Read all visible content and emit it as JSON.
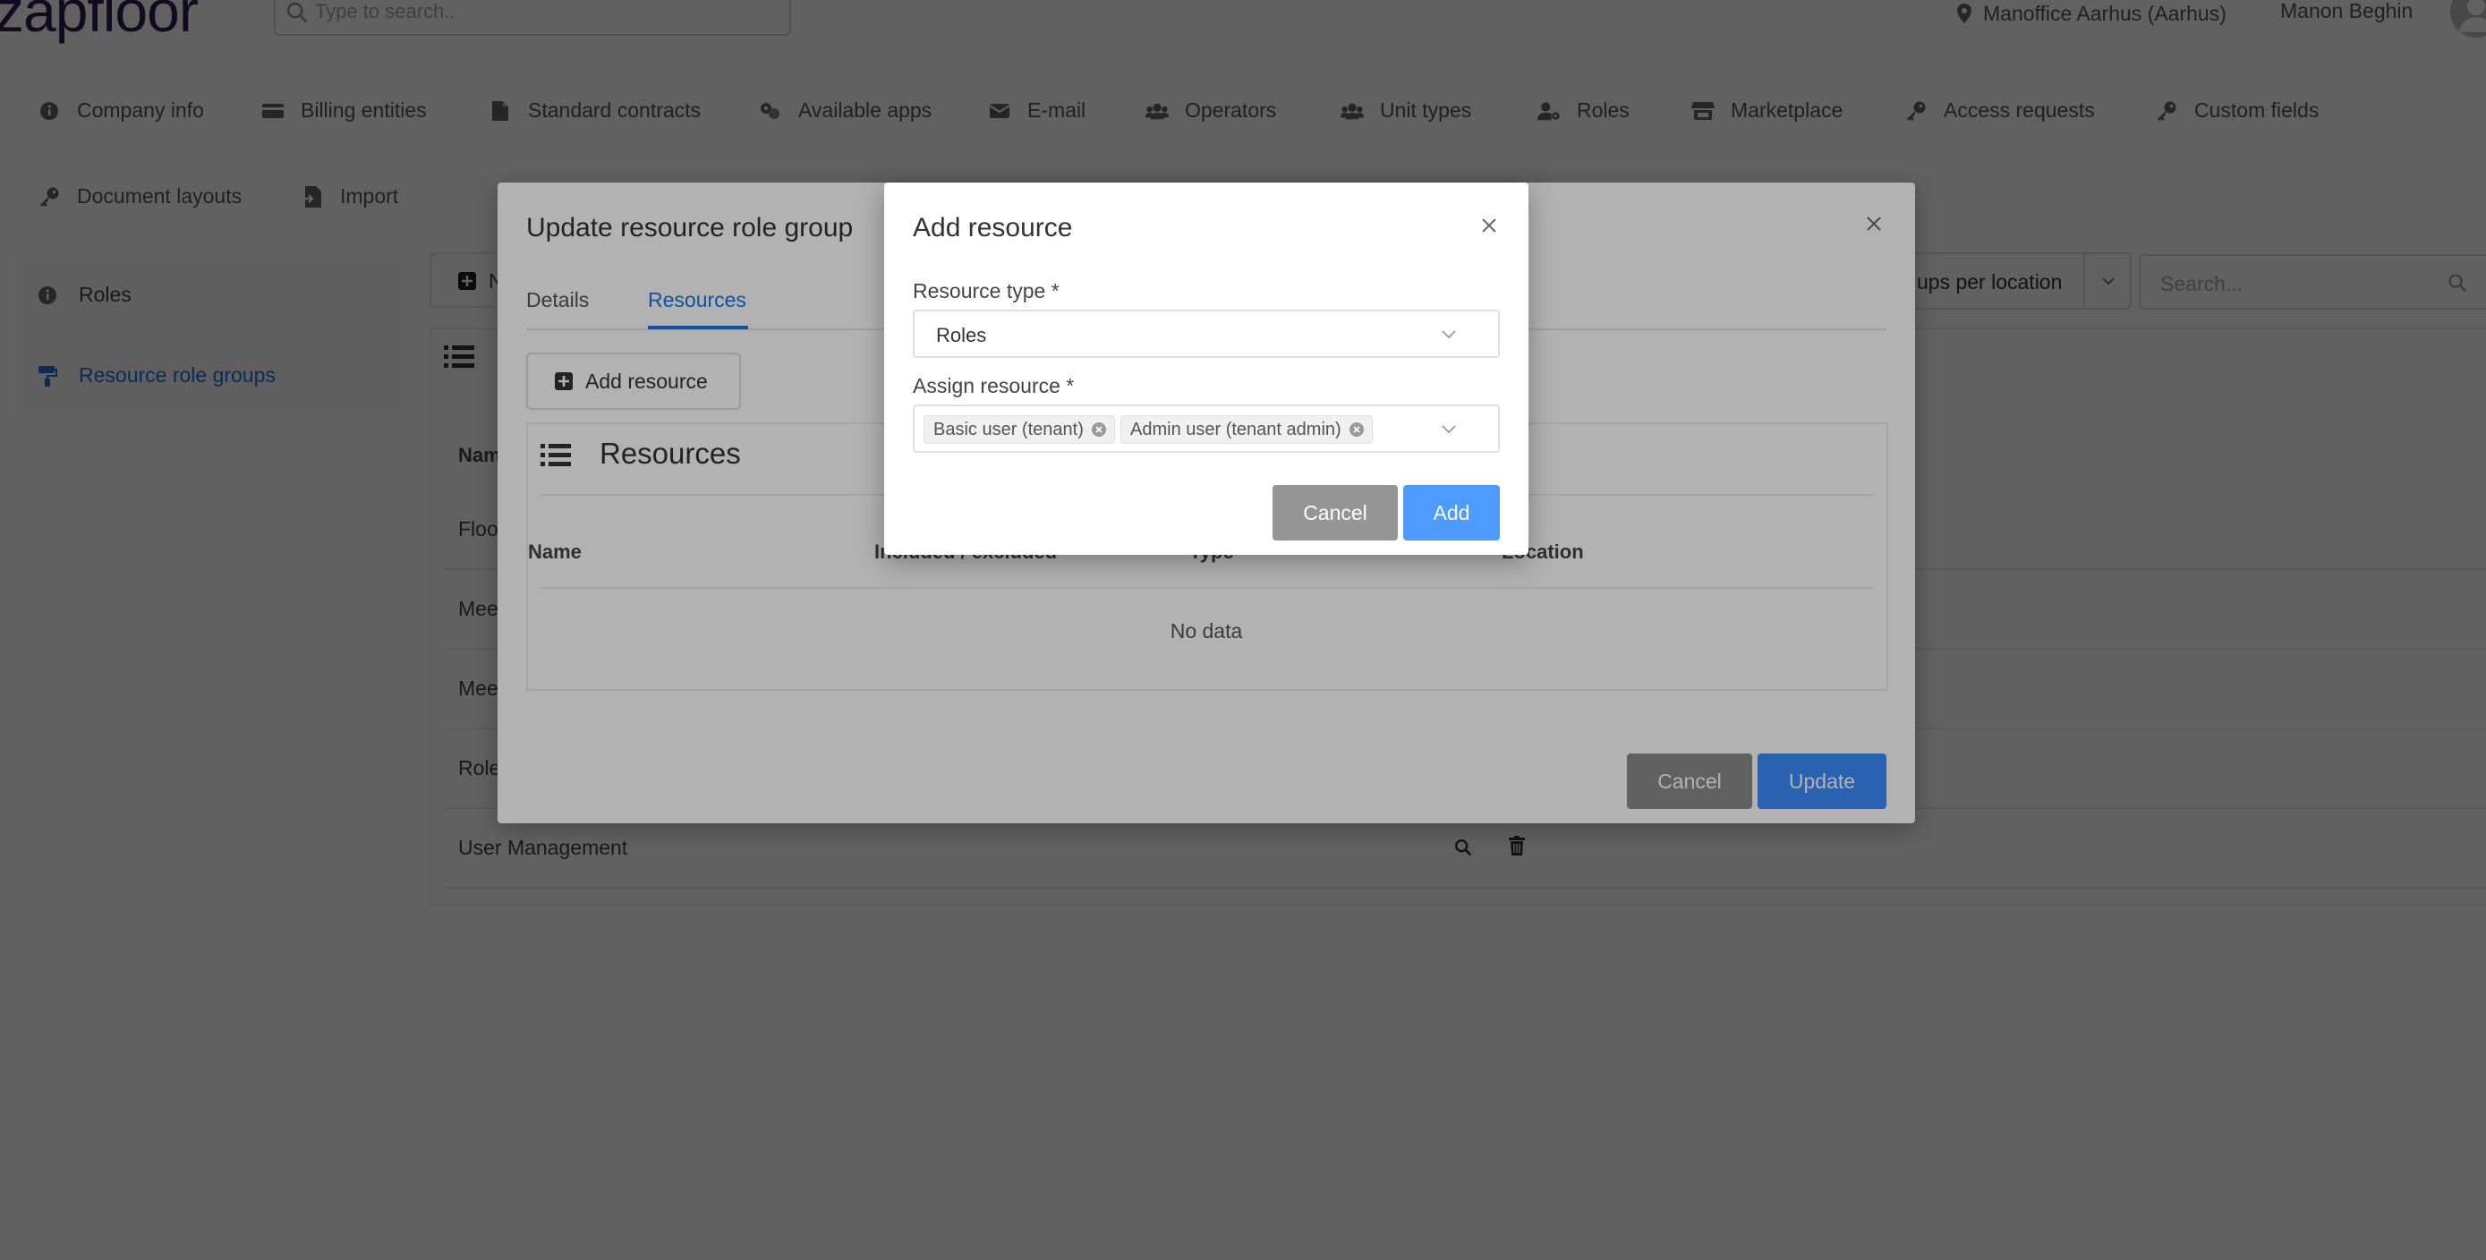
{
  "app": {
    "logo_text": "zapfloor",
    "search_placeholder": "Type to search..",
    "location": "Manoffice Aarhus (Aarhus)",
    "user_name": "Manon Beghin"
  },
  "nav": {
    "items": [
      {
        "label": "Company info",
        "icon": "info-icon"
      },
      {
        "label": "Billing entities",
        "icon": "billing-icon"
      },
      {
        "label": "Standard contracts",
        "icon": "document-icon"
      },
      {
        "label": "Available apps",
        "icon": "apps-icon"
      },
      {
        "label": "E-mail",
        "icon": "envelope-icon"
      },
      {
        "label": "Operators",
        "icon": "users-icon"
      },
      {
        "label": "Unit types",
        "icon": "users-icon"
      },
      {
        "label": "Roles",
        "icon": "user-cog-icon"
      },
      {
        "label": "Marketplace",
        "icon": "store-icon"
      },
      {
        "label": "Access requests",
        "icon": "key-icon"
      },
      {
        "label": "Custom fields",
        "icon": "key-icon"
      },
      {
        "label": "Document layouts",
        "icon": "key-icon"
      },
      {
        "label": "Import",
        "icon": "import-icon"
      }
    ]
  },
  "sidebar": {
    "items": [
      {
        "label": "Roles",
        "icon": "info-icon",
        "active": false
      },
      {
        "label": "Resource role groups",
        "icon": "paint-roller-icon",
        "active": true
      }
    ]
  },
  "toolbar": {
    "new_label": "N",
    "filter_value": "ups per location",
    "search_placeholder": "Search..."
  },
  "list": {
    "header_name": "Nam",
    "rows": [
      "Floo",
      "Mee",
      "Mee",
      "Role",
      "User Management"
    ]
  },
  "update_modal": {
    "title": "Update resource role group",
    "tabs": [
      "Details",
      "Resources"
    ],
    "active_tab": "Resources",
    "add_resource_label": "Add resource",
    "resources_title": "Resources",
    "columns": [
      "Name",
      "Included / excluded",
      "Type",
      "Location"
    ],
    "no_data": "No data",
    "cancel_label": "Cancel",
    "update_label": "Update"
  },
  "add_modal": {
    "title": "Add resource",
    "resource_type_label": "Resource type *",
    "resource_type_value": "Roles",
    "assign_label": "Assign resource *",
    "assigned_tags": [
      "Basic user (tenant)",
      "Admin user (tenant admin)"
    ],
    "cancel_label": "Cancel",
    "add_label": "Add"
  },
  "colors": {
    "accent": "#1a73e8",
    "primary_button": "#4d9bff",
    "secondary_button": "#959595",
    "logo": "#2b1e54"
  }
}
